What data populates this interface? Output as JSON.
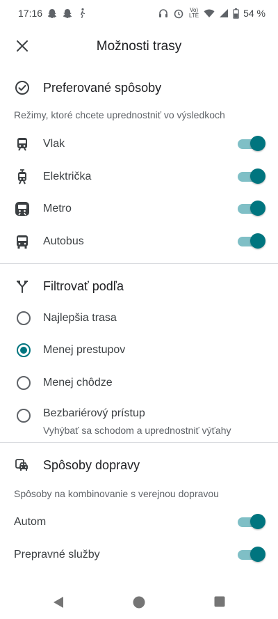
{
  "status_bar": {
    "time": "17:16",
    "network_label": "Vo) LTE",
    "battery": "54 %",
    "left_icons": [
      "snapchat-icon",
      "snapchat-icon",
      "walking-icon"
    ],
    "right_icons": [
      "headphones-icon",
      "alarm-icon",
      "wifi-icon",
      "signal-icon",
      "battery-icon"
    ]
  },
  "app_bar": {
    "title": "Možnosti trasy",
    "close_icon": "close-icon"
  },
  "preferred": {
    "heading": "Preferované spôsoby",
    "icon": "check-circle-icon",
    "subtitle": "Režimy, ktoré chcete uprednostniť vo výsledkoch",
    "items": [
      {
        "label": "Vlak",
        "icon": "train-icon",
        "enabled": true
      },
      {
        "label": "Električka",
        "icon": "tram-icon",
        "enabled": true
      },
      {
        "label": "Metro",
        "icon": "subway-icon",
        "enabled": true
      },
      {
        "label": "Autobus",
        "icon": "bus-icon",
        "enabled": true
      }
    ]
  },
  "filter": {
    "heading": "Filtrovať podľa",
    "icon": "route-split-icon",
    "options": [
      {
        "label": "Najlepšia trasa",
        "selected": false
      },
      {
        "label": "Menej prestupov",
        "selected": true
      },
      {
        "label": "Menej chôdze",
        "selected": false
      },
      {
        "label": "Bezbariérový prístup",
        "sublabel": "Vyhýbať sa schodom a uprednostniť výťahy",
        "selected": false
      }
    ]
  },
  "transport": {
    "heading": "Spôsoby dopravy",
    "icon": "car-transit-icon",
    "subtitle": "Spôsoby na kombinovanie s verejnou dopravou",
    "items": [
      {
        "label": "Autom",
        "enabled": true
      },
      {
        "label": "Prepravné služby",
        "enabled": true
      }
    ]
  },
  "nav_bar": [
    "back-icon",
    "home-icon",
    "recents-icon"
  ],
  "colors": {
    "accent": "#00757f",
    "toggle_track": "#7fbfc6",
    "divider": "#dadce0",
    "secondary_text": "#5f6368"
  }
}
